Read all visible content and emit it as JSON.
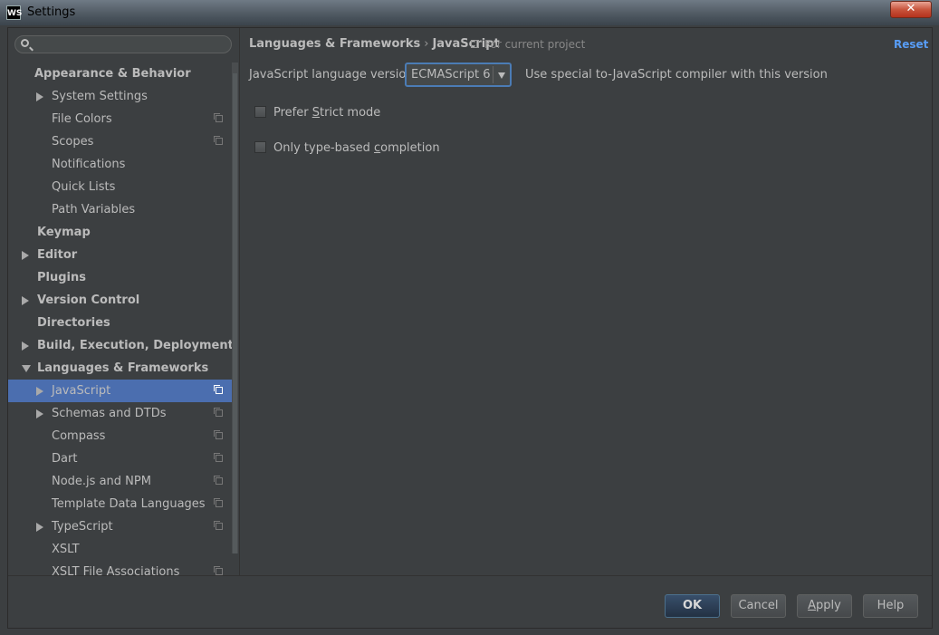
{
  "window": {
    "app_icon": "WS",
    "title": "Settings",
    "close_label": "✕"
  },
  "search": {
    "value": "",
    "placeholder": ""
  },
  "tree": [
    {
      "label": "Appearance & Behavior",
      "level": 0,
      "bold": true,
      "arrow": "none",
      "project": false
    },
    {
      "label": "System Settings",
      "level": 1,
      "bold": false,
      "arrow": "right",
      "project": false
    },
    {
      "label": "File Colors",
      "level": 1,
      "bold": false,
      "arrow": "none",
      "project": true
    },
    {
      "label": "Scopes",
      "level": 1,
      "bold": false,
      "arrow": "none",
      "project": true
    },
    {
      "label": "Notifications",
      "level": 1,
      "bold": false,
      "arrow": "none",
      "project": false
    },
    {
      "label": "Quick Lists",
      "level": 1,
      "bold": false,
      "arrow": "none",
      "project": false
    },
    {
      "label": "Path Variables",
      "level": 1,
      "bold": false,
      "arrow": "none",
      "project": false
    },
    {
      "label": "Keymap",
      "level": 0,
      "bold": true,
      "arrow": "none",
      "project": false
    },
    {
      "label": "Editor",
      "level": 0,
      "bold": true,
      "arrow": "right",
      "project": false
    },
    {
      "label": "Plugins",
      "level": 0,
      "bold": true,
      "arrow": "none",
      "project": false
    },
    {
      "label": "Version Control",
      "level": 0,
      "bold": true,
      "arrow": "right",
      "project": false
    },
    {
      "label": "Directories",
      "level": 0,
      "bold": true,
      "arrow": "none",
      "project": false
    },
    {
      "label": "Build, Execution, Deployment",
      "level": 0,
      "bold": true,
      "arrow": "right",
      "project": false
    },
    {
      "label": "Languages & Frameworks",
      "level": 0,
      "bold": true,
      "arrow": "down",
      "project": false
    },
    {
      "label": "JavaScript",
      "level": 1,
      "bold": false,
      "arrow": "right",
      "project": true,
      "selected": true
    },
    {
      "label": "Schemas and DTDs",
      "level": 1,
      "bold": false,
      "arrow": "right",
      "project": true
    },
    {
      "label": "Compass",
      "level": 1,
      "bold": false,
      "arrow": "none",
      "project": true
    },
    {
      "label": "Dart",
      "level": 1,
      "bold": false,
      "arrow": "none",
      "project": true
    },
    {
      "label": "Node.js and NPM",
      "level": 1,
      "bold": false,
      "arrow": "none",
      "project": true
    },
    {
      "label": "Template Data Languages",
      "level": 1,
      "bold": false,
      "arrow": "none",
      "project": true
    },
    {
      "label": "TypeScript",
      "level": 1,
      "bold": false,
      "arrow": "right",
      "project": true
    },
    {
      "label": "XSLT",
      "level": 1,
      "bold": false,
      "arrow": "none",
      "project": false
    },
    {
      "label": "XSLT File Associations",
      "level": 1,
      "bold": false,
      "arrow": "none",
      "project": true
    }
  ],
  "header": {
    "crumb_parent": "Languages & Frameworks",
    "crumb_sep": "›",
    "crumb_current": "JavaScript",
    "scope": "For current project",
    "reset": "Reset"
  },
  "js": {
    "version_label": "JavaScript language version",
    "version_value": "ECMAScript 6",
    "version_note": "Use special to-JavaScript compiler with this version",
    "strict_pre": "Prefer ",
    "strict_mnemonic": "S",
    "strict_post": "trict mode",
    "strict_checked": false,
    "typebased_pre": "Only type-based ",
    "typebased_mnemonic": "c",
    "typebased_post": "ompletion",
    "typebased_checked": false
  },
  "buttons": {
    "ok": "OK",
    "cancel": "Cancel",
    "apply_mnemonic": "A",
    "apply_rest": "pply",
    "help": "Help"
  },
  "colors": {
    "background": "#3c3f41",
    "selection": "#4b6eaf",
    "link": "#589df6",
    "text": "#bbbbbb"
  }
}
